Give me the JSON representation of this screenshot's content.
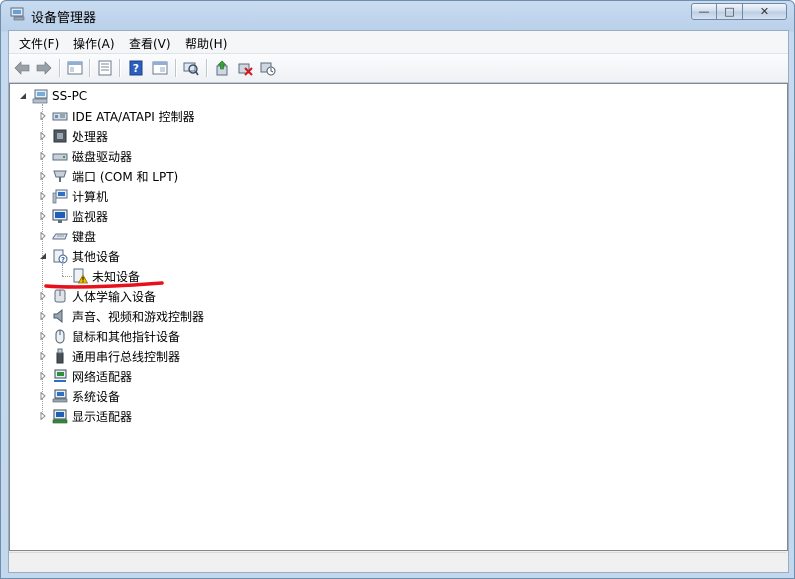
{
  "window": {
    "title": "设备管理器",
    "title_icon": "device-manager-icon"
  },
  "caption": {
    "minimize": "—",
    "maximize": "□",
    "close": "✕"
  },
  "menu": [
    {
      "label": "文件(F)"
    },
    {
      "label": "操作(A)"
    },
    {
      "label": "查看(V)"
    },
    {
      "label": "帮助(H)"
    }
  ],
  "toolbar": {
    "buttons": [
      "back-icon",
      "forward-icon",
      "show-hide-console-tree-icon",
      "properties-icon",
      "help-icon",
      "view-icon",
      "scan-hardware-icon",
      "update-driver-icon",
      "uninstall-icon",
      "disable-icon"
    ]
  },
  "tree": {
    "root": {
      "label": "SS-PC",
      "icon": "computer-icon",
      "expanded": true
    },
    "categories": [
      {
        "label": "IDE ATA/ATAPI 控制器",
        "icon": "ide-controller-icon",
        "expanded": false
      },
      {
        "label": "处理器",
        "icon": "processor-icon",
        "expanded": false
      },
      {
        "label": "磁盘驱动器",
        "icon": "disk-drive-icon",
        "expanded": false
      },
      {
        "label": "端口 (COM 和 LPT)",
        "icon": "port-icon",
        "expanded": false
      },
      {
        "label": "计算机",
        "icon": "computer-icon",
        "expanded": false
      },
      {
        "label": "监视器",
        "icon": "monitor-icon",
        "expanded": false
      },
      {
        "label": "键盘",
        "icon": "keyboard-icon",
        "expanded": false
      },
      {
        "label": "其他设备",
        "icon": "other-devices-icon",
        "expanded": true,
        "children": [
          {
            "label": "未知设备",
            "icon": "unknown-device-warning-icon",
            "highlighted": true
          }
        ]
      },
      {
        "label": "人体学输入设备",
        "icon": "hid-icon",
        "expanded": false
      },
      {
        "label": "声音、视频和游戏控制器",
        "icon": "speaker-icon",
        "expanded": false
      },
      {
        "label": "鼠标和其他指针设备",
        "icon": "mouse-icon",
        "expanded": false
      },
      {
        "label": "通用串行总线控制器",
        "icon": "usb-icon",
        "expanded": false
      },
      {
        "label": "网络适配器",
        "icon": "network-adapter-icon",
        "expanded": false
      },
      {
        "label": "系统设备",
        "icon": "system-device-icon",
        "expanded": false
      },
      {
        "label": "显示适配器",
        "icon": "display-adapter-icon",
        "expanded": false
      }
    ]
  },
  "annotation": {
    "underline_color": "#e8101a"
  },
  "colors": {
    "title_bar": "#c9dcf0",
    "tree_background": "#ffffff",
    "warning": "#f5c400"
  }
}
